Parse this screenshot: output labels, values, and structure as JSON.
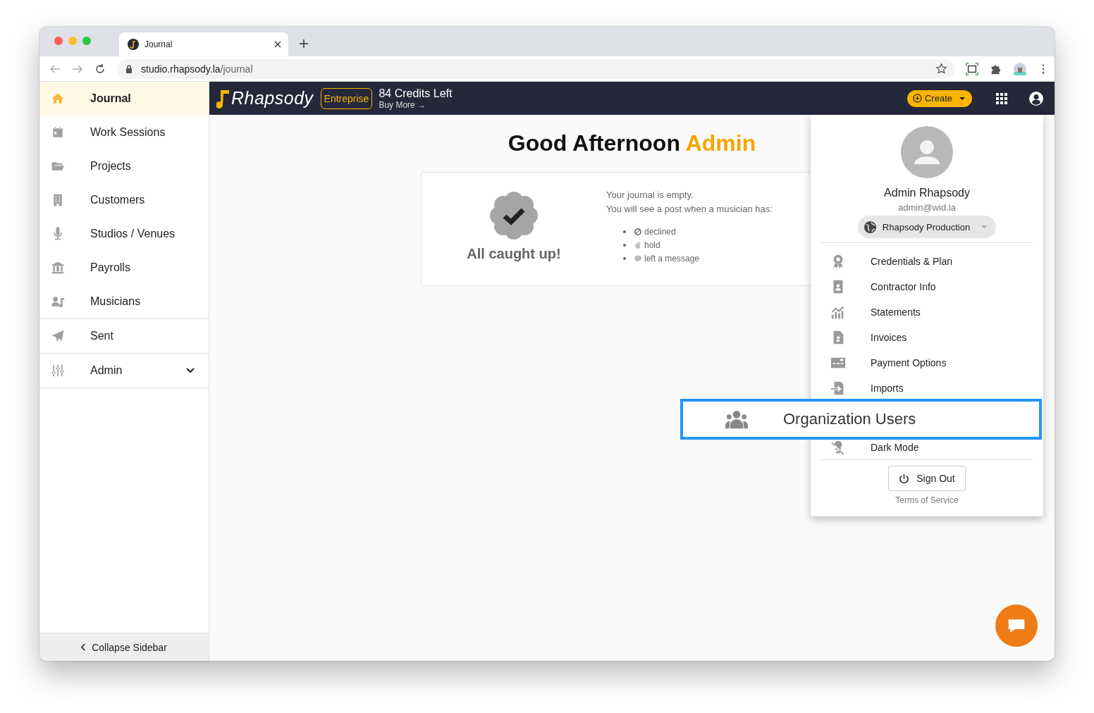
{
  "browser": {
    "tab_title": "Journal",
    "url_host": "studio.rhapsody.la",
    "url_path": "/journal"
  },
  "sidebar": {
    "sections": [
      {
        "items": [
          {
            "label": "Journal",
            "selected": true
          },
          {
            "label": "Work Sessions",
            "selected": false
          },
          {
            "label": "Projects",
            "selected": false
          },
          {
            "label": "Customers",
            "selected": false
          },
          {
            "label": "Studios / Venues",
            "selected": false
          },
          {
            "label": "Payrolls",
            "selected": false
          },
          {
            "label": "Musicians",
            "selected": false
          }
        ]
      },
      {
        "items": [
          {
            "label": "Sent",
            "selected": false
          }
        ]
      },
      {
        "items": [
          {
            "label": "Admin",
            "selected": false,
            "expanded": false
          }
        ]
      }
    ],
    "collapse": "Collapse Sidebar"
  },
  "header": {
    "logo": "Rhapsody",
    "plan": "Entreprise",
    "credits": "84 Credits Left",
    "buy_more": "Buy More →",
    "create": "Create"
  },
  "greeting": {
    "prefix": "Good Afternoon",
    "name": "Admin"
  },
  "journal_card": {
    "title": "All caught up!",
    "line_1": "Your journal is empty.",
    "line_2": "You will see a post when a musician has:",
    "reasons": [
      {
        "label": "declined"
      },
      {
        "label": "hold"
      },
      {
        "label": "left a message"
      }
    ]
  },
  "profile_menu": {
    "name": "Admin Rhapsody",
    "email": "admin@wid.la",
    "organization": "Rhapsody Production",
    "items": [
      {
        "label": "Credentials & Plan"
      },
      {
        "label": "Contractor Info"
      },
      {
        "label": "Statements"
      },
      {
        "label": "Invoices"
      },
      {
        "label": "Payment Options"
      },
      {
        "label": "Imports"
      },
      {
        "label": "Dark Mode"
      }
    ],
    "sign_out": "Sign Out",
    "terms": "Terms of Service"
  },
  "callout": {
    "label": "Organization Users"
  }
}
